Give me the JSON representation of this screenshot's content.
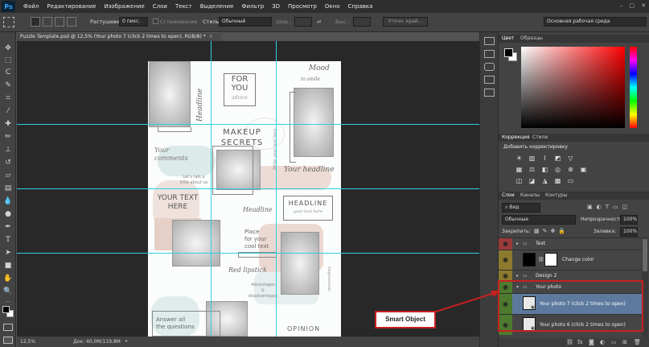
{
  "app": {
    "logo": "Ps"
  },
  "menu": [
    "Файл",
    "Редактирование",
    "Изображение",
    "Слои",
    "Текст",
    "Выделение",
    "Фильтр",
    "3D",
    "Просмотр",
    "Окно",
    "Справка"
  ],
  "options": {
    "feather_label": "Растушевка:",
    "feather_value": "0 пикс.",
    "antialias_label": "Сглаживание",
    "style_label": "Стиль:",
    "style_value": "Обычный",
    "width_label": "Шир.:",
    "height_label": "Выс.:",
    "refine_label": "Уточн. край...",
    "workspace_value": "Основная рабочая среда"
  },
  "document": {
    "tab_title": "Puzzle Template.psd @ 12,5% (Your photo 7 (click 2 times to open), RGB/8) *",
    "close_glyph": "×"
  },
  "poster": {
    "for_you": "FOR\nYOU",
    "advice": "advice",
    "headline_vert": "Headline",
    "mood": "Mood",
    "to_smile": "to smile",
    "makeup": "MAKEUP\nSECRETS",
    "your_comments": "Your\ncomments",
    "lets_talk": "Let's talk a\nlittle about us",
    "your_headline": "Your headline",
    "write_vert": "Write your text here",
    "your_text_here": "YOUR TEXT\nHERE",
    "headline_box": "HEADLINE",
    "your_text_small": "your text here",
    "headline_script": "Headline",
    "place_cool": "Place\nfor your\ncool text",
    "red_lipstick": "Red lipstick",
    "adv_disadv": "Advantages\n&\ndisadvantages",
    "answer_all": "Answer all\nthe questions",
    "opinion": "OPINION",
    "impressions_vert": "Impressions"
  },
  "callout": {
    "label": "Smart Object"
  },
  "status": {
    "zoom": "12,5%",
    "doc_size": "Док: 40,0M/119,8M"
  },
  "color_panel": {
    "tabs": [
      "Цвет",
      "Образцы"
    ],
    "hue_color": "#ff0000"
  },
  "adjust_panel": {
    "tabs": [
      "Коррекция",
      "Стили"
    ],
    "title": "Добавить корректировку"
  },
  "layers_panel": {
    "tabs": [
      "Слои",
      "Каналы",
      "Контуры"
    ],
    "filter_label": "Вид",
    "blend_mode": "Обычные",
    "opacity_label": "Непрозрачность:",
    "opacity_value": "100%",
    "lock_label": "Закрепить:",
    "fill_label": "Заливка:",
    "fill_value": "100%",
    "layers": [
      {
        "name": "Text",
        "color": "#9c3a3a",
        "type": "folder"
      },
      {
        "name": "Change color",
        "color": "#8d7a2e",
        "type": "adjustment"
      },
      {
        "name": "Design 2",
        "color": "#8d7a2e",
        "type": "folder"
      },
      {
        "name": "Your photo",
        "color": "#4e7a2e",
        "type": "folder"
      },
      {
        "name": "Your photo 7 (click 2 times to open)",
        "color": "#4e7a2e",
        "type": "smart-object",
        "selected": true
      },
      {
        "name": "Your photo 6 (click 2 times to open)",
        "color": "#4e7a2e",
        "type": "smart-object"
      }
    ]
  },
  "colors": {
    "accent_red": "#c62020",
    "selected_row": "#5d7a9e",
    "guide": "#2fd0e0"
  }
}
